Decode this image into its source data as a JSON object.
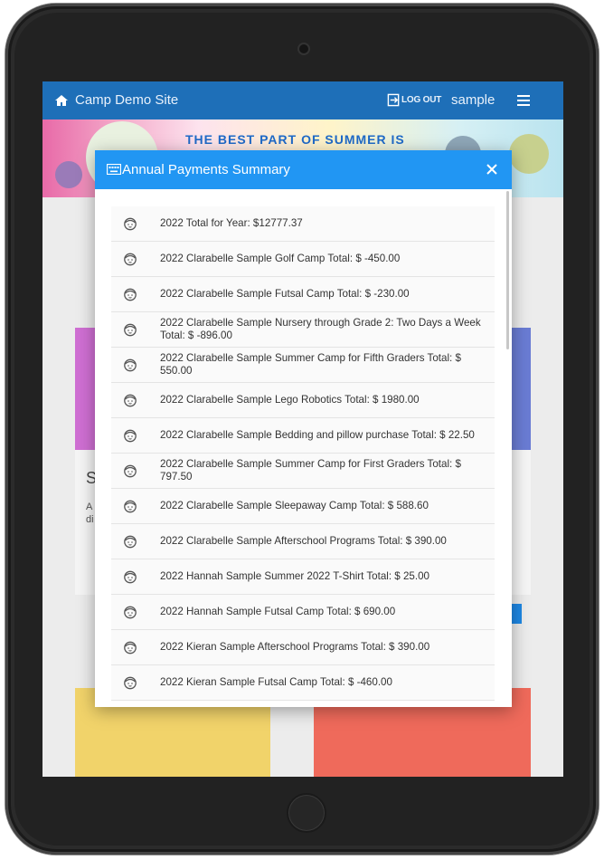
{
  "topnav": {
    "site_title": "Camp Demo Site",
    "logout_label": "LOG OUT",
    "username": "sample"
  },
  "banner": {
    "text": "THE BEST PART OF SUMMER IS"
  },
  "background_card": {
    "heading_letter": "S",
    "text_fragment": "A\ndi"
  },
  "modal": {
    "title": "Annual Payments Summary",
    "items": [
      "2022 Total for Year: $12777.37",
      "2022 Clarabelle Sample Golf Camp Total: $ -450.00",
      "2022 Clarabelle Sample Futsal Camp Total: $ -230.00",
      "2022 Clarabelle Sample Nursery through Grade 2: Two Days a Week Total: $ -896.00",
      "2022 Clarabelle Sample Summer Camp for Fifth Graders Total: $ 550.00",
      "2022 Clarabelle Sample Lego Robotics Total: $ 1980.00",
      "2022 Clarabelle Sample Bedding and pillow purchase Total: $ 22.50",
      "2022 Clarabelle Sample Summer Camp for First Graders Total: $ 797.50",
      "2022 Clarabelle Sample Sleepaway Camp Total: $ 588.60",
      "2022 Clarabelle Sample Afterschool Programs Total: $ 390.00",
      "2022 Hannah Sample Summer 2022 T-Shirt Total: $ 25.00",
      "2022 Hannah Sample Futsal Camp Total: $ 690.00",
      "2022 Kieran Sample Afterschool Programs Total: $ 390.00",
      "2022 Kieran Sample Futsal Camp Total: $ -460.00"
    ],
    "item_icon": "child-face-icon"
  },
  "colors": {
    "nav_bg": "#1e6fb8",
    "modal_header_bg": "#2196f3",
    "banner_text": "#1f6ac8"
  }
}
